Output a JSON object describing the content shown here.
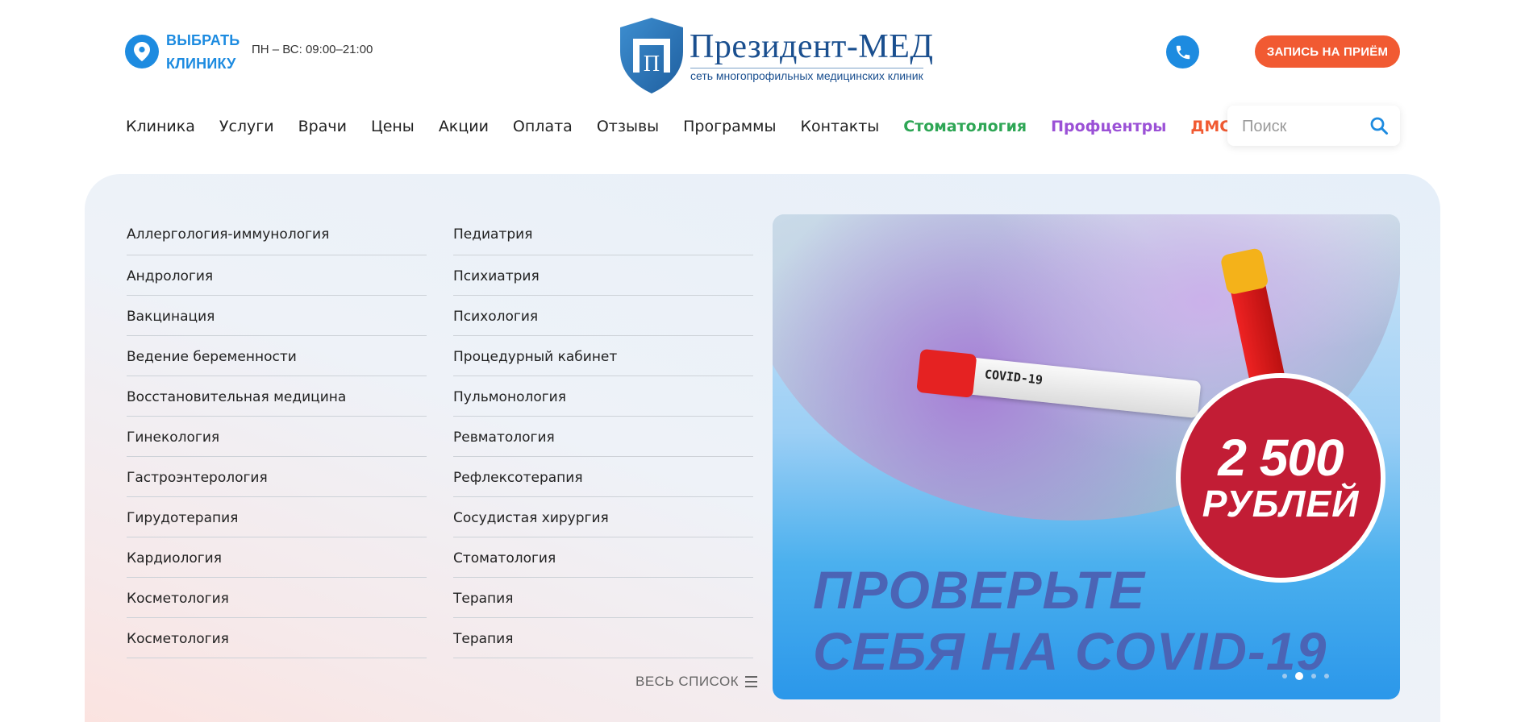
{
  "header": {
    "choose_clinic": "ВЫБРАТЬ КЛИНИКУ",
    "hours": "ПН – ВС: 09:00–21:00",
    "logo_title": "Президент-МЕД",
    "logo_subtitle": "сеть многопрофильных медицинских клиник",
    "appointment_button": "ЗАПИСЬ НА ПРИЁМ"
  },
  "nav": {
    "items": [
      {
        "label": "Клиника"
      },
      {
        "label": "Услуги"
      },
      {
        "label": "Врачи"
      },
      {
        "label": "Цены"
      },
      {
        "label": "Акции"
      },
      {
        "label": "Оплата"
      },
      {
        "label": "Отзывы"
      },
      {
        "label": "Программы"
      },
      {
        "label": "Контакты"
      },
      {
        "label": "Стоматология"
      },
      {
        "label": "Профцентры"
      },
      {
        "label": "ДМС"
      }
    ]
  },
  "search": {
    "placeholder": "Поиск"
  },
  "services": {
    "col1": [
      "Аллергология-иммунология",
      "Андрология",
      "Вакцинация",
      "Ведение беременности",
      "Восстановительная медицина",
      "Гинекология",
      "Гастроэнтерология",
      "Гирудотерапия",
      "Кардиология",
      "Косметология",
      "Косметология"
    ],
    "col2": [
      "Педиатрия",
      "Психиатрия",
      "Психология",
      "Процедурный кабинет",
      "Пульмонология",
      "Ревматология",
      "Рефлексотерапия",
      "Сосудистая хирургия",
      "Стоматология",
      "Терапия",
      "Терапия"
    ],
    "all_list": "ВЕСЬ СПИСОК"
  },
  "banner": {
    "tube_label": "COVID-19",
    "price_number": "2 500",
    "price_currency": "РУБЛЕЙ",
    "headline_line1": "ПРОВЕРЬТЕ",
    "headline_line2": "СЕБЯ НА COVID-19",
    "slides_total": 4,
    "active_slide": 2
  },
  "colors": {
    "accent_blue": "#1d8be0",
    "accent_orange": "#f15a32",
    "dental_green": "#2ea655",
    "prof_purple": "#9b51d6",
    "badge_red": "#c21d35"
  }
}
